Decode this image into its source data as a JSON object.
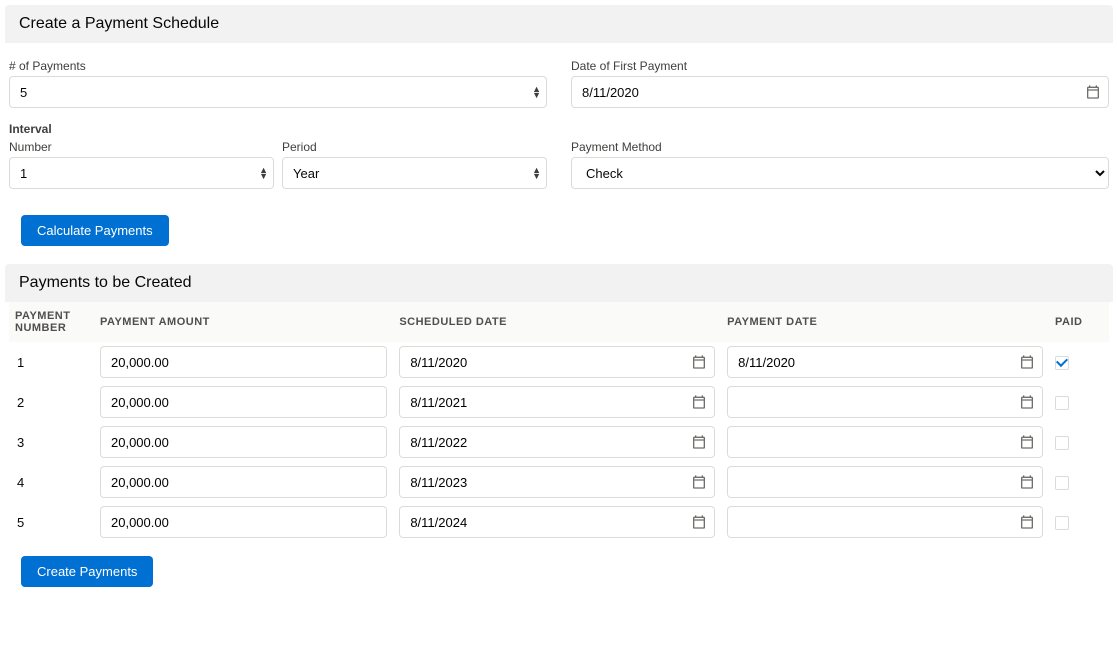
{
  "schedule_section": {
    "title": "Create a Payment Schedule",
    "num_payments_label": "# of Payments",
    "num_payments_value": "5",
    "first_payment_date_label": "Date of First Payment",
    "first_payment_date_value": "8/11/2020",
    "interval_label": "Interval",
    "interval_number_label": "Number",
    "interval_number_value": "1",
    "interval_period_label": "Period",
    "interval_period_value": "Year",
    "payment_method_label": "Payment Method",
    "payment_method_value": "Check",
    "calculate_button": "Calculate Payments"
  },
  "results_section": {
    "title": "Payments to be Created",
    "headers": {
      "number": "Payment Number",
      "amount": "Payment Amount",
      "scheduled": "Scheduled Date",
      "payment_date": "Payment Date",
      "paid": "Paid"
    },
    "rows": [
      {
        "n": "1",
        "amount": "20,000.00",
        "scheduled": "8/11/2020",
        "payment_date": "8/11/2020",
        "paid": true
      },
      {
        "n": "2",
        "amount": "20,000.00",
        "scheduled": "8/11/2021",
        "payment_date": "",
        "paid": false
      },
      {
        "n": "3",
        "amount": "20,000.00",
        "scheduled": "8/11/2022",
        "payment_date": "",
        "paid": false
      },
      {
        "n": "4",
        "amount": "20,000.00",
        "scheduled": "8/11/2023",
        "payment_date": "",
        "paid": false
      },
      {
        "n": "5",
        "amount": "20,000.00",
        "scheduled": "8/11/2024",
        "payment_date": "",
        "paid": false
      }
    ],
    "create_button": "Create Payments"
  }
}
